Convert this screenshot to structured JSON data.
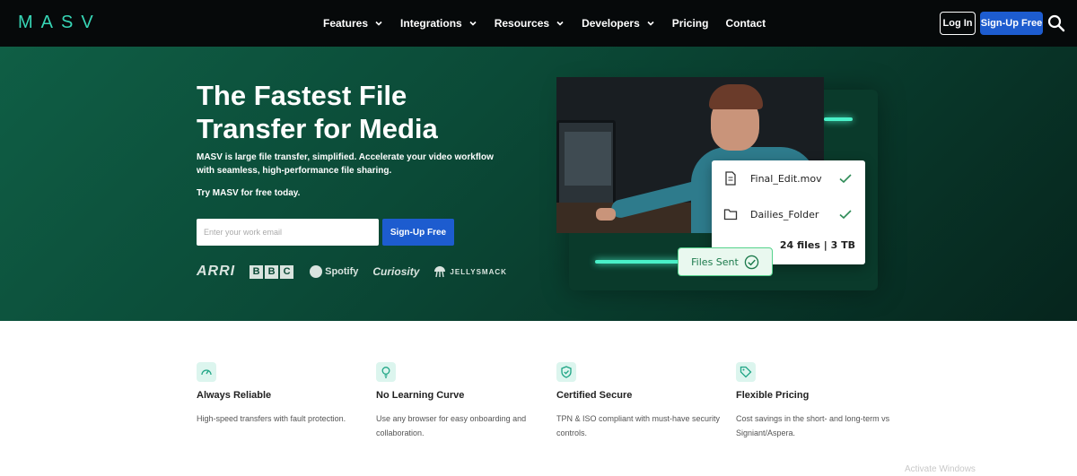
{
  "nav": {
    "logo": "MASV",
    "menu": [
      {
        "label": "Features",
        "dropdown": true
      },
      {
        "label": "Integrations",
        "dropdown": true
      },
      {
        "label": "Resources",
        "dropdown": true
      },
      {
        "label": "Developers",
        "dropdown": true
      },
      {
        "label": "Pricing",
        "dropdown": false
      },
      {
        "label": "Contact",
        "dropdown": false
      }
    ],
    "login_label": "Log In",
    "signup_label": "Sign-Up Free",
    "search_icon": "search-icon"
  },
  "hero": {
    "title": "The Fastest File Transfer for Media",
    "subtitle": "MASV is large file transfer, simplified. Accelerate your video workflow with seamless, high-performance file sharing.",
    "try_text": "Try MASV for free today.",
    "email_placeholder": "Enter your work email",
    "signup_label": "Sign-Up Free",
    "clients": [
      "ARRI",
      "BBC",
      "Spotify",
      "Curiosity",
      "JELLYSMACK"
    ]
  },
  "transfer_card": {
    "files": [
      {
        "name": "Final_Edit.mov",
        "icon": "file-icon",
        "status_icon": "check-icon"
      },
      {
        "name": "Dailies_Folder",
        "icon": "folder-icon",
        "status_icon": "check-icon"
      }
    ],
    "total": "24 files | 3 TB",
    "sent_label": "Files Sent"
  },
  "features": [
    {
      "icon": "speedometer-icon",
      "title": "Always Reliable",
      "desc": "High-speed transfers with fault protection."
    },
    {
      "icon": "lightbulb-icon",
      "title": "No Learning Curve",
      "desc": "Use any browser for easy onboarding and collaboration."
    },
    {
      "icon": "shield-check-icon",
      "title": "Certified Secure",
      "desc": "TPN & ISO compliant with must-have security controls."
    },
    {
      "icon": "price-tag-icon",
      "title": "Flexible Pricing",
      "desc": "Cost savings in the short- and long-term vs Signiant/Aspera."
    }
  ],
  "watermark": "Activate Windows",
  "colors": {
    "accent": "#37d6b6",
    "cta_blue": "#1d5ccf",
    "hero_green": "#0b4a37",
    "nav_bg": "#06090a"
  }
}
